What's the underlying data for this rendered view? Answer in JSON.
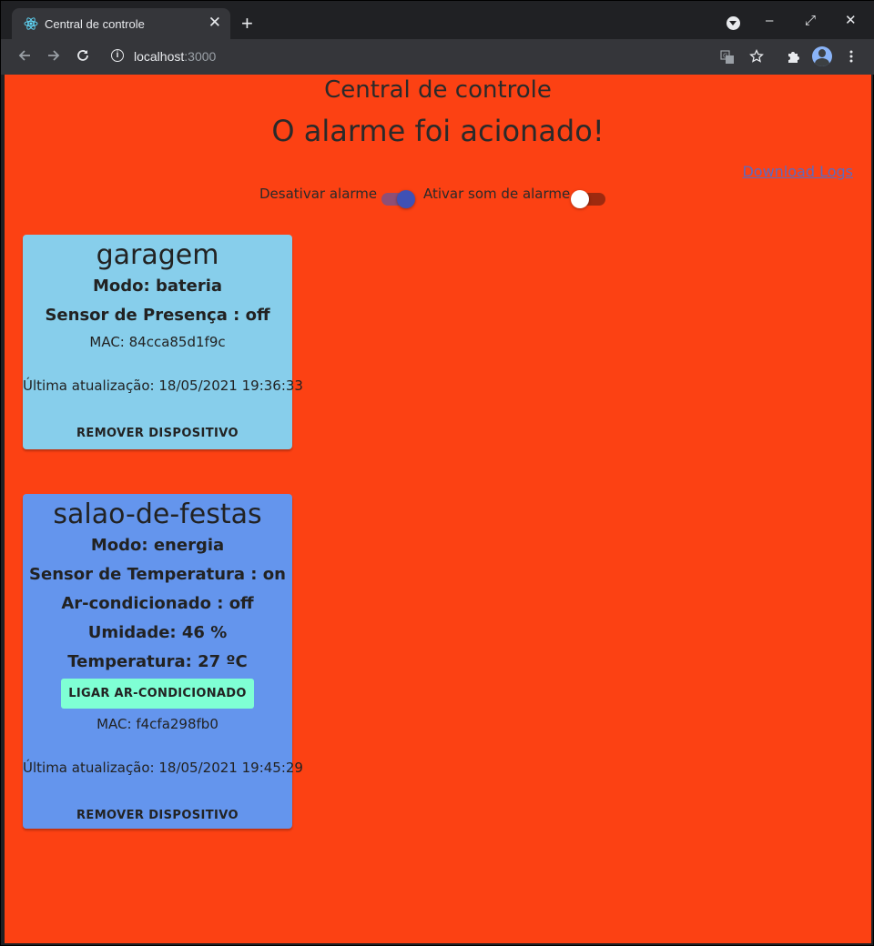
{
  "browser": {
    "tab_title": "Central de controle",
    "close_glyph": "✕",
    "new_tab_glyph": "+",
    "url_host": "localhost",
    "url_port": ":3000",
    "window_controls": {
      "minimize": "–",
      "maximize": "⤢",
      "close": "✕"
    }
  },
  "header": {
    "title": "Central de controle",
    "alarm_message": "O alarme foi acionado!",
    "download_logs": "Download Logs"
  },
  "controls": {
    "disable_alarm_label": "Desativar alarme",
    "disable_alarm_on": true,
    "alarm_sound_label": "Ativar som de alarme",
    "alarm_sound_on": false
  },
  "devices": [
    {
      "name": "garagem",
      "mode": "Modo: bateria",
      "sensor": "Sensor de Presença : off",
      "mac": "MAC: 84cca85d1f9c",
      "updated": "Última atualização: 18/05/2021 19:36:33",
      "remove": "REMOVER DISPOSITIVO"
    },
    {
      "name": "salao-de-festas",
      "mode": "Modo: energia",
      "sensor": "Sensor de Temperatura : on",
      "ac": "Ar-condicionado : off",
      "humidity": "Umidade: 46 %",
      "temperature": "Temperatura: 27 ºC",
      "action": "LIGAR AR-CONDICIONADO",
      "mac": "MAC: f4cfa298fb0",
      "updated": "Última atualização: 18/05/2021 19:45:29",
      "remove": "REMOVER DISPOSITIVO"
    }
  ],
  "colors": {
    "page_bg": "#fc4113",
    "card_garagem": "#87ceeb",
    "card_salao": "#6495ed",
    "action_button": "#7fffd4",
    "switch_on": "#3f51b5",
    "switch_off_thumb": "#ffffff"
  },
  "icons": [
    "react-icon",
    "back-arrow-icon",
    "forward-arrow-icon",
    "reload-icon",
    "info-icon",
    "translate-icon",
    "star-icon",
    "extensions-icon",
    "avatar",
    "kebab-menu-icon",
    "profile-dropdown-icon"
  ]
}
